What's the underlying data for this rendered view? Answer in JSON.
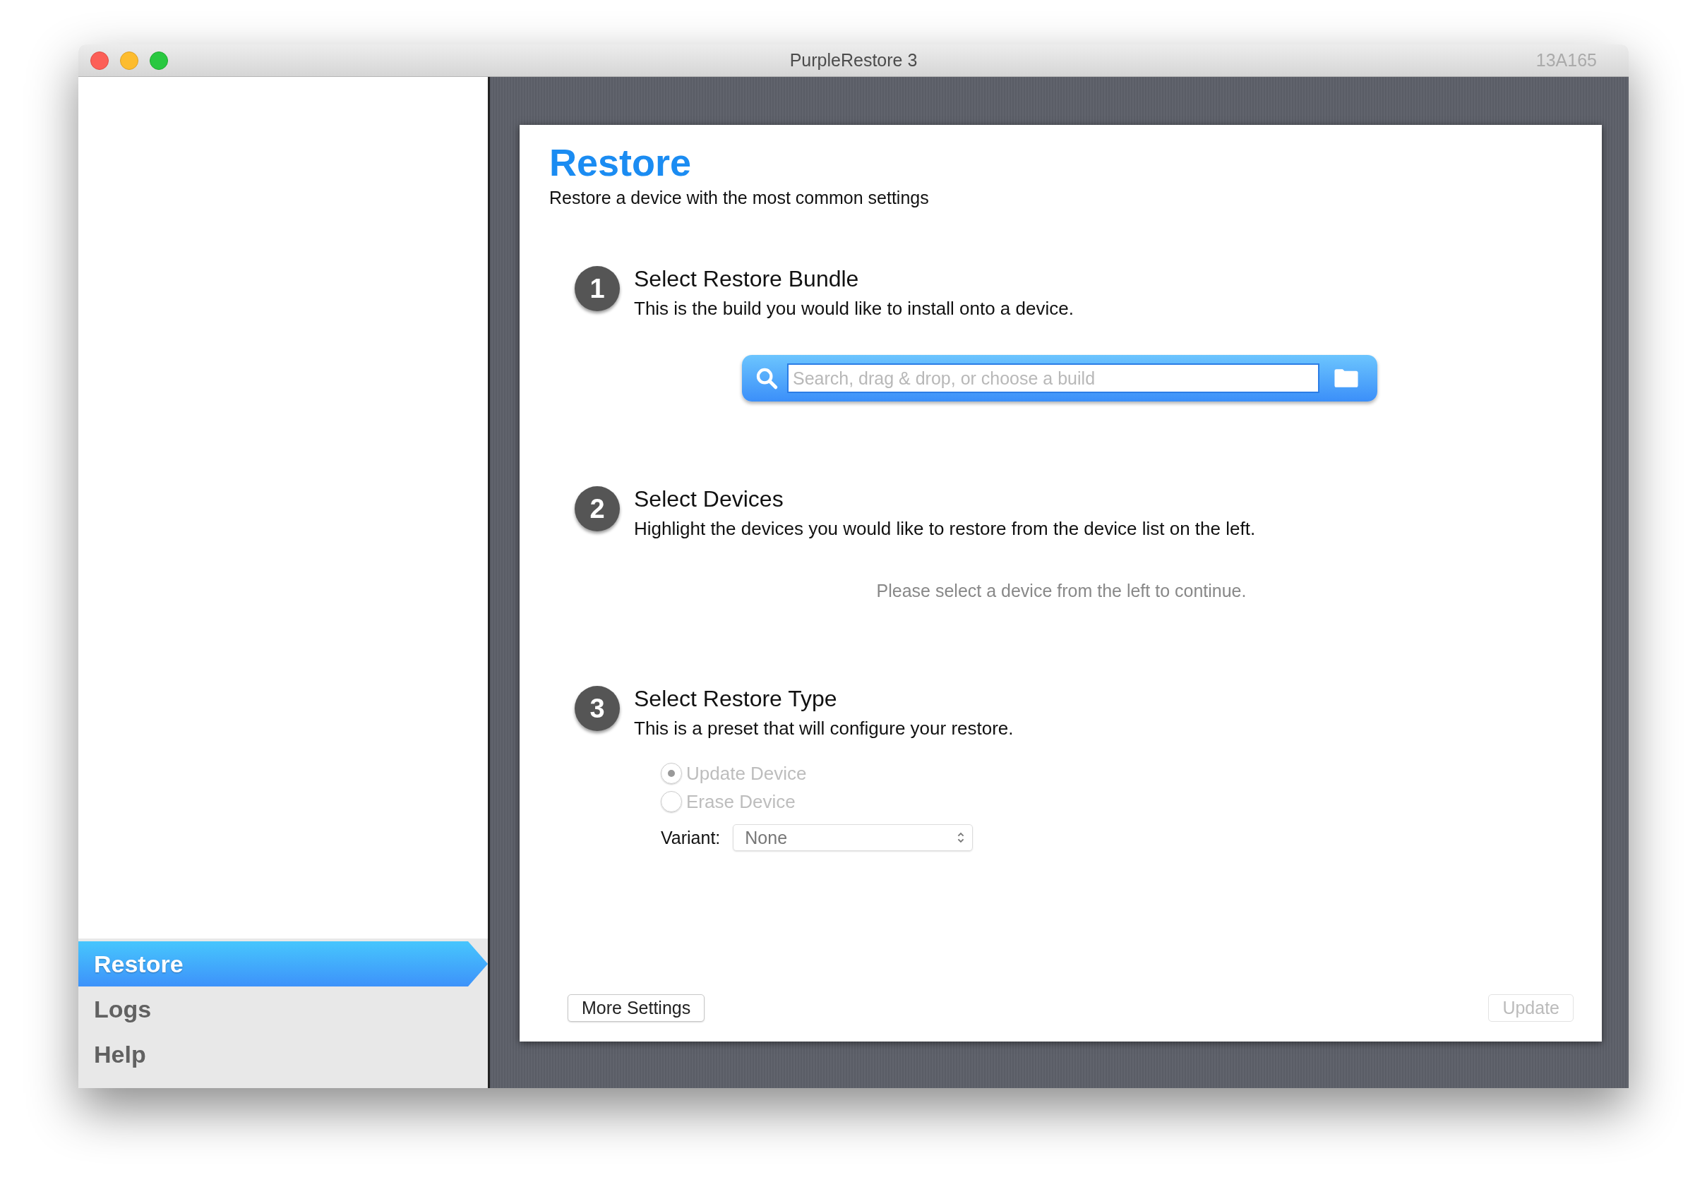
{
  "window": {
    "title": "PurpleRestore 3",
    "build": "13A165"
  },
  "sidebar": {
    "items": [
      {
        "label": "Restore",
        "selected": true
      },
      {
        "label": "Logs",
        "selected": false
      },
      {
        "label": "Help",
        "selected": false
      }
    ]
  },
  "page": {
    "title": "Restore",
    "subtitle": "Restore a device with the most common settings"
  },
  "steps": [
    {
      "number": "1",
      "title": "Select Restore Bundle",
      "description": "This is the build you would like to install onto a device.",
      "kind": "search",
      "placeholder": "Search, drag & drop, or choose a build"
    },
    {
      "number": "2",
      "title": "Select Devices",
      "description": "Highlight the devices you would like to restore from the device list on the left.",
      "kind": "message",
      "message": "Please select a device from the left to continue."
    },
    {
      "number": "3",
      "title": "Select Restore Type",
      "description": "This is a preset that will configure your restore.",
      "kind": "options",
      "options": [
        {
          "label": "Update Device",
          "selected": true,
          "disabled": true
        },
        {
          "label": "Erase Device",
          "selected": false,
          "disabled": true
        }
      ],
      "variant_label": "Variant:",
      "variant_value": "None"
    }
  ],
  "buttons": [
    {
      "label": "More Settings",
      "disabled": false
    },
    {
      "label": "Update",
      "disabled": true
    }
  ]
}
